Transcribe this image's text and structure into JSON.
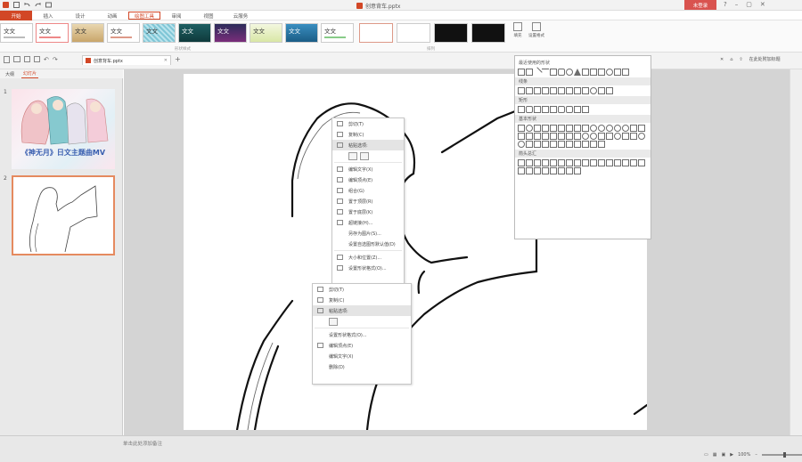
{
  "titlebar": {
    "document_title": "创意背车.pptx",
    "login_button": "未登录"
  },
  "tabs": [
    {
      "label": "开始",
      "active": true
    },
    {
      "label": "插入",
      "active": false
    },
    {
      "label": "设计",
      "active": false
    },
    {
      "label": "动画",
      "active": false
    },
    {
      "label": "绘图工具",
      "active": false,
      "format": true
    },
    {
      "label": "审阅",
      "active": false
    },
    {
      "label": "视图",
      "active": false
    },
    {
      "label": "云服务",
      "active": false
    }
  ],
  "ribbon": {
    "style_swatches": [
      "文文",
      "文文",
      "文文",
      "文文",
      "文文",
      "文文",
      "文文",
      "文文",
      "文文",
      "文文"
    ],
    "group_label_styles": "形状样式",
    "group_label_arrange": "排列",
    "buttons": [
      {
        "label": "填充"
      },
      {
        "label": "设置格式"
      }
    ]
  },
  "docbar": {
    "doc_tab": "创意背车.pptx",
    "right_action": "在此处附加标题"
  },
  "leftpane": {
    "tabs": [
      "大纲",
      "幻灯片"
    ],
    "slides": [
      {
        "num": "1",
        "title": "《神无月》日文主题曲MV"
      },
      {
        "num": "2"
      }
    ]
  },
  "context_menu_1": {
    "items": [
      "剪切(T)",
      "复制(C)",
      "粘贴选项:",
      "",
      "",
      "编辑文字(X)",
      "编辑顶点(E)",
      "组合(G)",
      "置于顶层(R)",
      "置于底层(K)",
      "超链接(H)...",
      "另存为图片(S)...",
      "设置自选图形默认值(D)",
      "",
      "大小和位置(Z)...",
      "设置形状格式(O)..."
    ]
  },
  "context_menu_2": {
    "items": [
      "剪切(T)",
      "复制(C)",
      "粘贴选项:",
      "",
      "设置形状格式(O)...",
      "编辑顶点(E)",
      "编辑文字(X)",
      "删除(D)"
    ]
  },
  "shapes_gallery": {
    "title": "最近使用的形状",
    "categories": [
      "线条",
      "矩形",
      "基本形状",
      "箭头总汇"
    ]
  },
  "status": {
    "note": "单击此处添加备注",
    "zoom": "100%"
  }
}
